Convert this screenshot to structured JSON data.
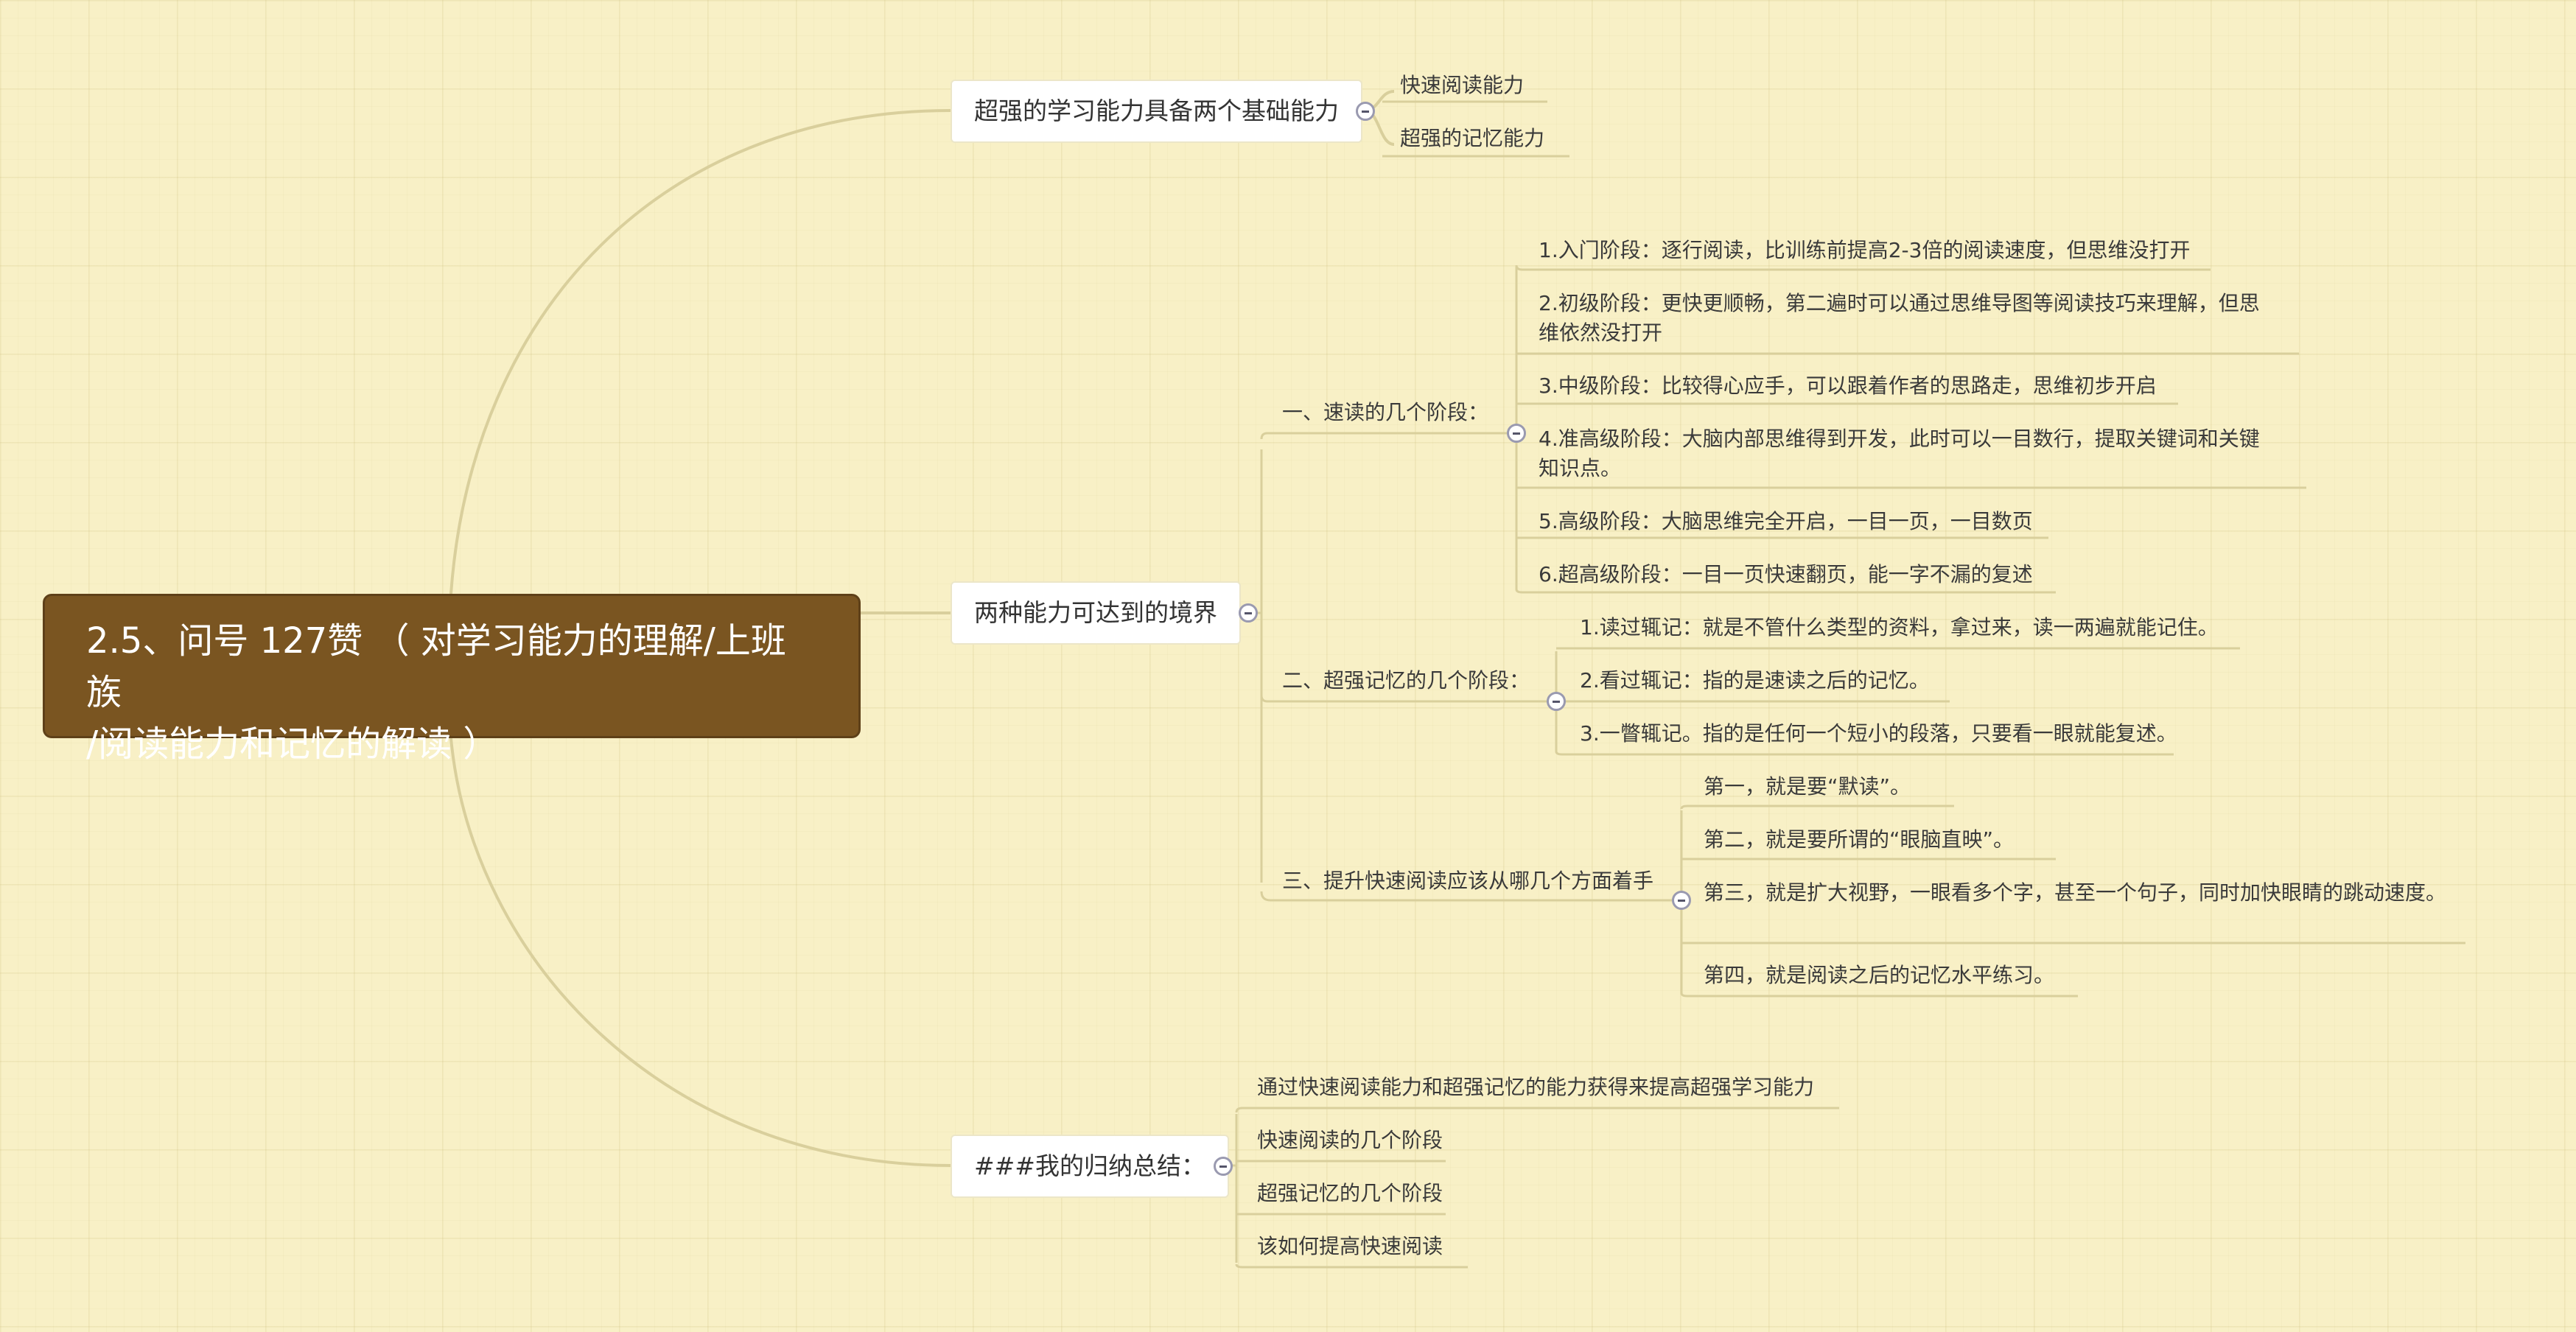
{
  "root": {
    "line1": "2.5、问号  127赞  （ 对学习能力的理解/上班族",
    "line2": "/阅读能力和记忆的解读 ）"
  },
  "branch1": {
    "label": "超强的学习能力具备两个基础能力",
    "items": [
      "快速阅读能力",
      "超强的记忆能力"
    ]
  },
  "branch2": {
    "label": "两种能力可达到的境界",
    "sub1": {
      "label": "一、速读的几个阶段：",
      "items": [
        "1.入门阶段：逐行阅读，比训练前提高2-3倍的阅读速度，但思维没打开",
        "2.初级阶段：更快更顺畅，第二遍时可以通过思维导图等阅读技巧来理解，但思维依然没打开",
        "3.中级阶段：比较得心应手，可以跟着作者的思路走，思维初步开启",
        "4.准高级阶段：大脑内部思维得到开发，此时可以一目数行，提取关键词和关键知识点。",
        "5.高级阶段：大脑思维完全开启，一目一页，一目数页",
        "6.超高级阶段：一目一页快速翻页，能一字不漏的复述"
      ]
    },
    "sub2": {
      "label": "二、超强记忆的几个阶段：",
      "items": [
        "1.读过辄记：就是不管什么类型的资料，拿过来，读一两遍就能记住。",
        "2.看过辄记：指的是速读之后的记忆。",
        "3.一瞥辄记。指的是任何一个短小的段落，只要看一眼就能复述。"
      ]
    },
    "sub3": {
      "label": "三、提升快速阅读应该从哪几个方面着手",
      "items": [
        "第一，就是要“默读”。",
        "第二，就是要所谓的“眼脑直映”。",
        "第三，就是扩大视野，一眼看多个字，甚至一个句子，同时加快眼睛的跳动速度。",
        "第四，就是阅读之后的记忆水平练习。"
      ]
    }
  },
  "branch3": {
    "label": "###我的归纳总结：",
    "items": [
      "通过快速阅读能力和超强记忆的能力获得来提高超强学习能力",
      "快速阅读的几个阶段",
      "超强记忆的几个阶段",
      "该如何提高快速阅读"
    ]
  },
  "colors": {
    "background": "#f8f0c6",
    "root_fill": "#7a5521",
    "connector": "#d9cf9c"
  }
}
